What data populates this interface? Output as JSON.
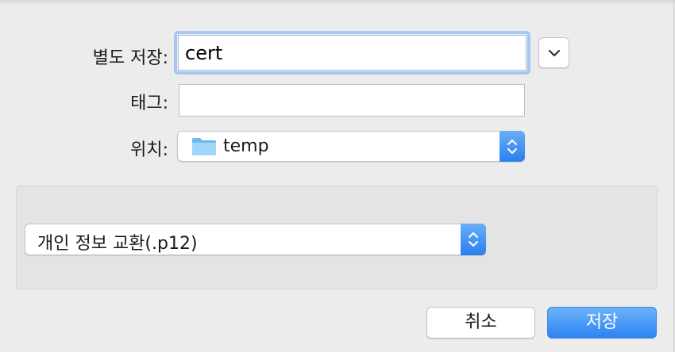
{
  "dialog": {
    "save_as_label": "별도 저장:",
    "filename_value": "cert",
    "tags_label": "태그:",
    "tags_value": "",
    "location_label": "위치:",
    "location_value": "temp",
    "format_value": "개인 정보 교환(.p12)",
    "cancel_label": "취소",
    "save_label": "저장"
  },
  "icons": {
    "expand": "chevron-down-icon",
    "location_folder": "folder-icon",
    "popup_arrows": "up-down-arrows-icon"
  },
  "colors": {
    "accent": "#2d83f2",
    "focus_ring": "#a7c7f0",
    "folder": "#8ccbf5"
  }
}
